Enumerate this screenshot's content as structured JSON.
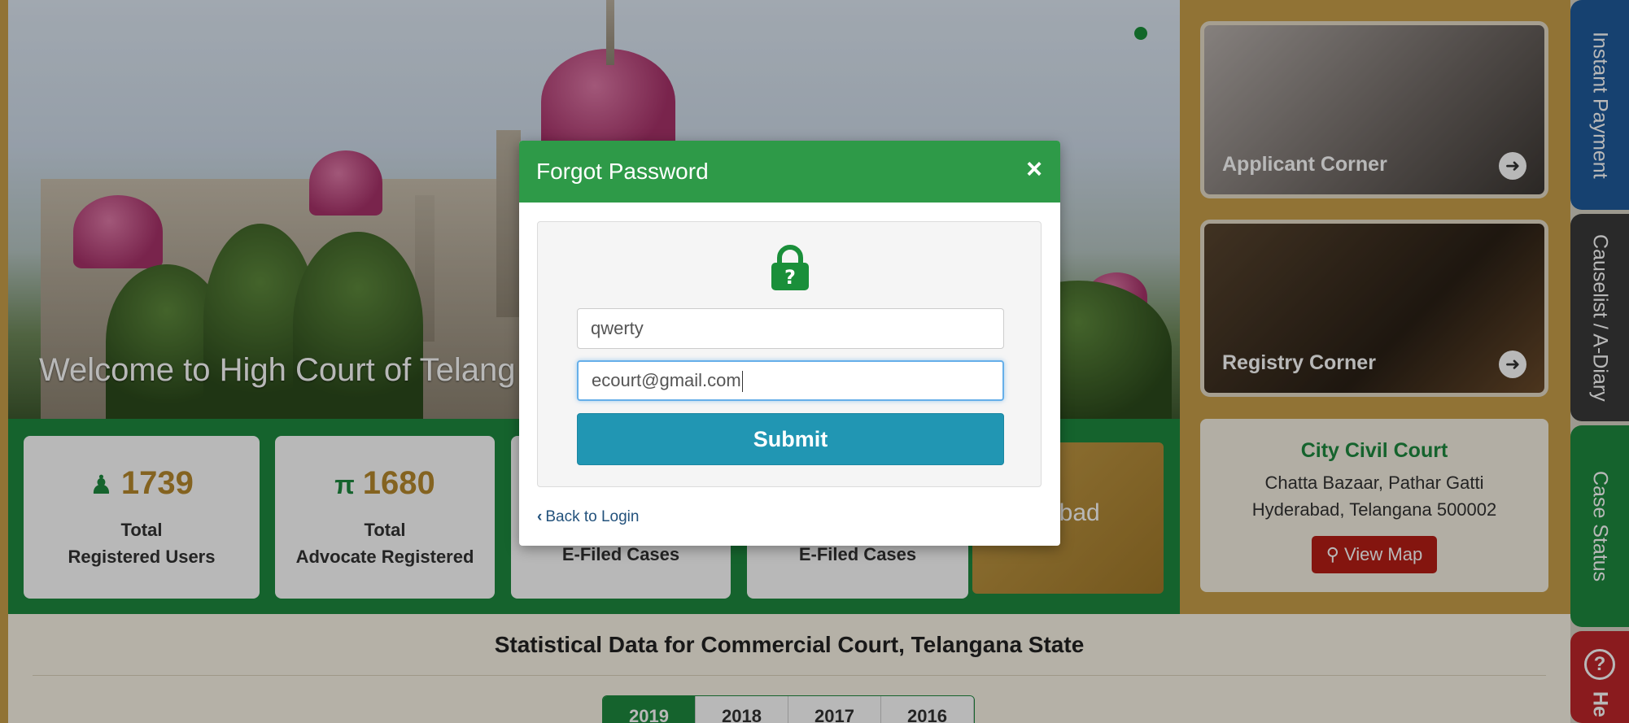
{
  "hero": {
    "welcome_text": "Welcome to High Court of Telang"
  },
  "stats_cards": [
    {
      "icon": "user-icon",
      "number": "1739",
      "label_line1": "Total",
      "label_line2": "Registered Users"
    },
    {
      "icon": "advocate-icon",
      "number": "1680",
      "label_line1": "Total",
      "label_line2": "Advocate Registered"
    },
    {
      "label_line2": "E-Filed Cases"
    },
    {
      "label_line2": "E-Filed Cases"
    }
  ],
  "gold_card": {
    "partial_text": "rabad"
  },
  "right_panel": {
    "applicant_corner": "Applicant Corner",
    "registry_corner": "Registry Corner",
    "court": {
      "title": "City Civil Court",
      "address_line1": "Chatta Bazaar, Pathar Gatti",
      "address_line2": "Hyderabad, Telangana 500002",
      "map_button": "View Map"
    }
  },
  "side_tabs": {
    "instant_payment": "Instant Payment",
    "causelist": "Causelist / A-Diary",
    "case_status": "Case Status",
    "help_label": "He"
  },
  "statistics": {
    "title": "Statistical Data for Commercial Court, Telangana State",
    "years": [
      "2019",
      "2018",
      "2017",
      "2016"
    ],
    "active_year": "2019"
  },
  "modal": {
    "title": "Forgot Password",
    "close": "×",
    "username_value": "qwerty",
    "email_value": "ecourt@gmail.com",
    "submit_label": "Submit",
    "back_label": "Back to Login"
  },
  "colors": {
    "header_green": "#2e9a48",
    "submit_blue": "#2196b3",
    "lock_green": "#1a8f3a",
    "accent_gold": "#c9a04a"
  }
}
